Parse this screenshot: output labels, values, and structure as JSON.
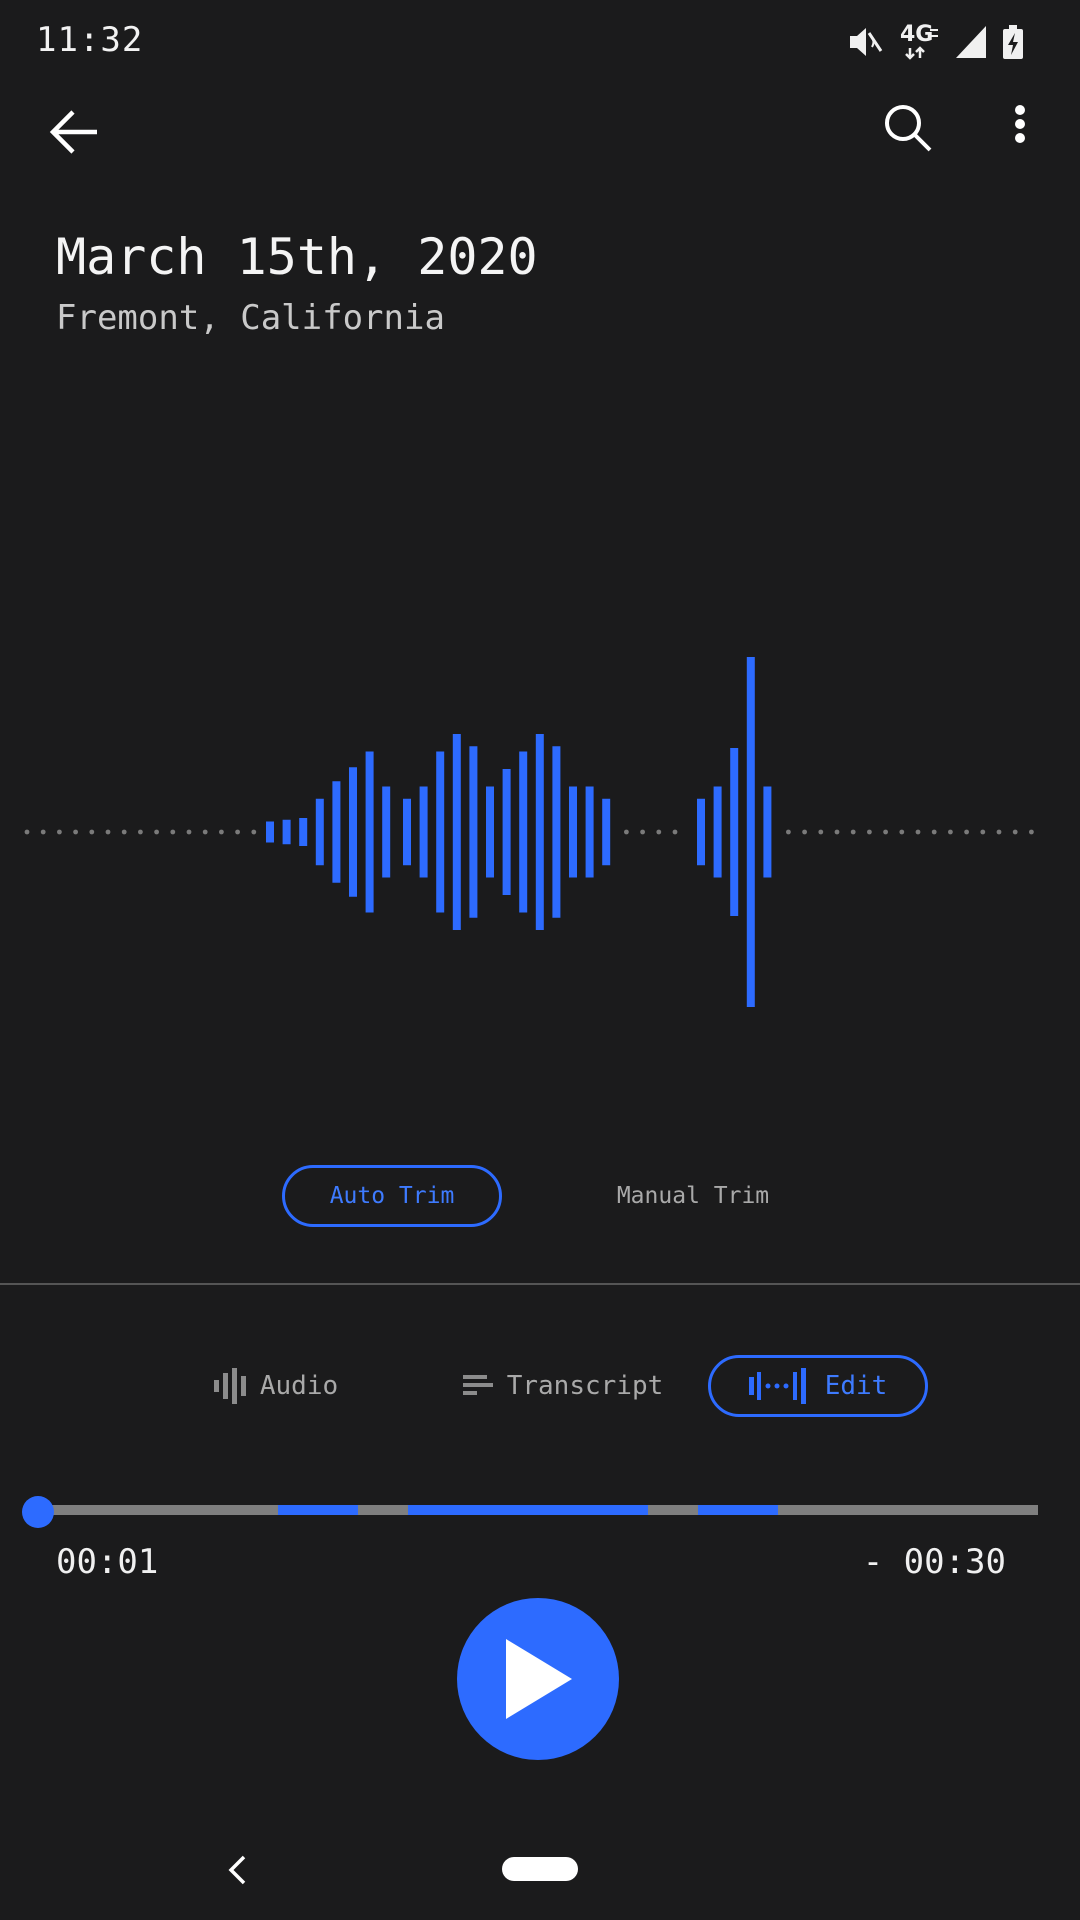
{
  "status_bar": {
    "time": "11:32",
    "network_label": "4G",
    "icons": [
      "mute-icon",
      "4g-lte-icon",
      "cell-signal-icon",
      "battery-charging-icon"
    ]
  },
  "toolbar": {
    "icons": [
      "back-arrow-icon",
      "search-icon",
      "more-vert-icon"
    ]
  },
  "recording": {
    "title": "March 15th, 2020",
    "location": "Fremont, California"
  },
  "waveform": {
    "bar_heights": [
      [
        0.06,
        0.07,
        0.08,
        0.19,
        0.29,
        0.37,
        0.46,
        0.26
      ],
      [
        0.19,
        0.26,
        0.46,
        0.56,
        0.49,
        0.26,
        0.36,
        0.46,
        0.56,
        0.49,
        0.26,
        0.26,
        0.19
      ],
      [
        0.19,
        0.26,
        0.48,
        1.0,
        0.26
      ]
    ],
    "colors": {
      "bar": "#2d6bff",
      "dot": "#7a7a7a"
    }
  },
  "trim": {
    "auto_label": "Auto Trim",
    "manual_label": "Manual Trim",
    "selected": "auto"
  },
  "tabs": {
    "audio_label": "Audio",
    "transcript_label": "Transcript",
    "edit_label": "Edit",
    "selected": "edit"
  },
  "playback": {
    "elapsed": "00:01",
    "remaining": "- 00:30",
    "progress": 0.0,
    "active_segments": [
      [
        0.24,
        0.32
      ],
      [
        0.37,
        0.61
      ],
      [
        0.66,
        0.74
      ]
    ]
  },
  "colors": {
    "background": "#1b1b1c",
    "accent": "#2d6bff",
    "inactive_track": "#7f7f7f"
  }
}
